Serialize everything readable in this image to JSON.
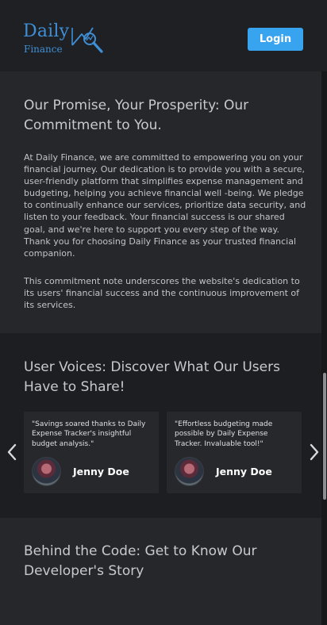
{
  "header": {
    "logo_word": "Daily",
    "logo_sub": "Finance",
    "login_label": "Login"
  },
  "promise": {
    "title": "Our Promise, Your Prosperity: Our Commitment to You.",
    "paragraph1": "At Daily Finance, we are committed to empowering you on your financial journey. Our dedication is to provide you with a secure, user-friendly platform that simplifies expense management and budgeting, helping you achieve financial well -being. We pledge to continually enhance our services, prioritize data security, and listen to your feedback. Your financial success is our shared goal, and we're here to support you every step of the way. Thank you for choosing Daily Finance as your trusted financial companion.",
    "paragraph2": "This commitment note underscores the website's dedication to its users' financial success and the continuous improvement of its services."
  },
  "voices": {
    "title": "User Voices: Discover What Our Users Have to Share!",
    "testimonials": [
      {
        "quote": "\"Savings soared thanks to Daily Expense Tracker's insightful budget analysis.\"",
        "name": "Jenny Doe"
      },
      {
        "quote": "\"Effortless budgeting made possible by Daily Expense Tracker. Invaluable tool!\"",
        "name": "Jenny Doe"
      }
    ]
  },
  "developer": {
    "title": "Behind the Code: Get to Know Our Developer's Story"
  },
  "icons": {
    "logo": "chart-magnifier-icon",
    "prev": "chevron-left-icon",
    "next": "chevron-right-icon"
  },
  "colors": {
    "accent": "#38a3ee",
    "brand": "#3f8fd6",
    "background": "#1f2023"
  }
}
